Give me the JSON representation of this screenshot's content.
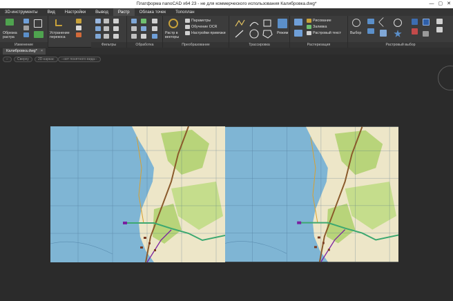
{
  "window": {
    "title": "Платформа nanoCAD x64 23 - не для коммерческого использования Калибровка.dwg*",
    "controls": [
      "—",
      "▢",
      "✕"
    ]
  },
  "menu": {
    "tabs": [
      "3D-инструменты",
      "Вид",
      "Настройки",
      "Вывод",
      "Растр",
      "Облака точек",
      "Топоплан"
    ],
    "active": "Растр"
  },
  "ribbon": {
    "groups": {
      "change": "Изменение",
      "filters": "Фильтры",
      "processing": "Обработка",
      "conversion": "Преобразование",
      "tracing": "Трассировка",
      "rasterization": "Растеризация",
      "raster_select": "Растровый выбор"
    },
    "buttons": {
      "crop_raster": "Обрезка растра",
      "fix_skew": "Устранение перекоса",
      "raster_to_vector": "Растр в векторы",
      "parameters": "Параметры",
      "train_ocr": "Обучение OCR",
      "link_settings": "Настройки привязки",
      "mode": "Режим",
      "drawing": "Рисование",
      "fill": "Заливка",
      "raster_text": "Растровый текст",
      "select": "Выбор"
    }
  },
  "document": {
    "tab_label": "Калибровка.dwg*",
    "close_glyph": "×"
  },
  "viewport": {
    "controls": [
      "−",
      "Сверху",
      "2D-каркас",
      "--нет понятного вида--"
    ]
  },
  "colors": {
    "water": "#7fb5d4",
    "land": "#ede6c8",
    "forest": "#b8d47a",
    "road": "#8a5a2b",
    "boundary": "#3ca870",
    "accent": "#7a1fa0"
  }
}
